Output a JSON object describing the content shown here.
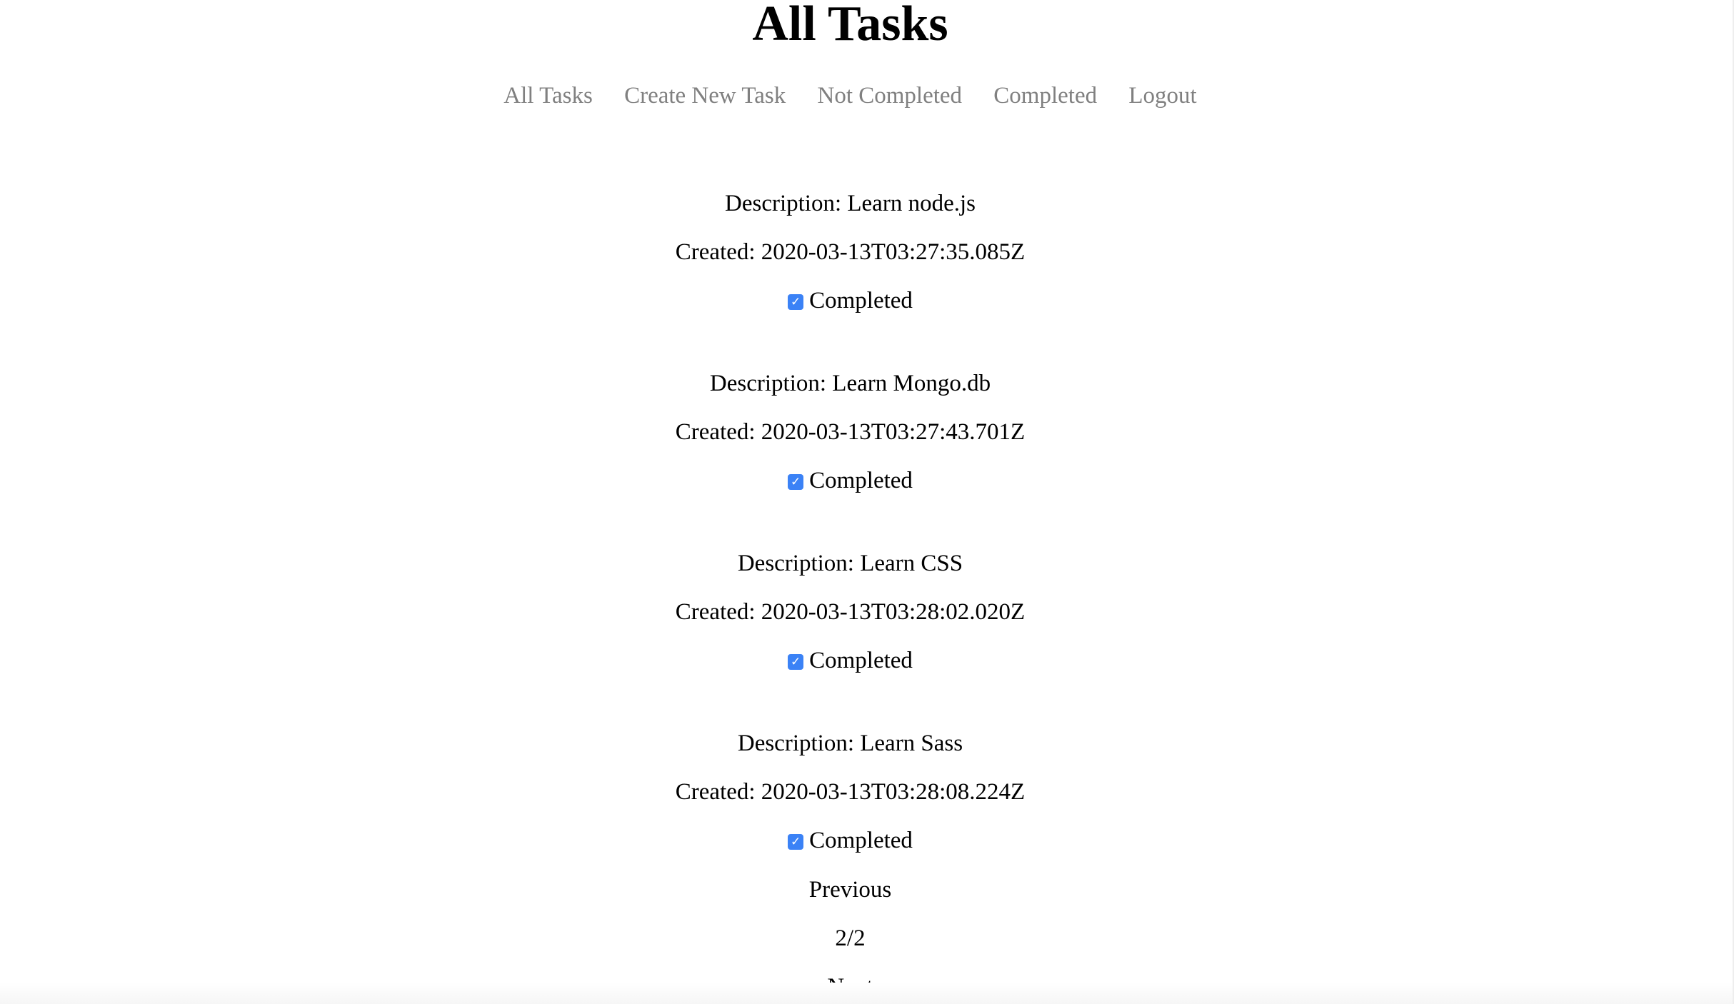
{
  "header": {
    "title": "All Tasks"
  },
  "nav": {
    "items": [
      {
        "label": "All Tasks"
      },
      {
        "label": "Create New Task"
      },
      {
        "label": "Not Completed"
      },
      {
        "label": "Completed"
      },
      {
        "label": "Logout"
      }
    ]
  },
  "tasks": [
    {
      "description": "Description: Learn node.js",
      "created": "Created: 2020-03-13T03:27:35.085Z",
      "completed_label": "Completed",
      "checked": true
    },
    {
      "description": "Description: Learn Mongo.db",
      "created": "Created: 2020-03-13T03:27:43.701Z",
      "completed_label": "Completed",
      "checked": true
    },
    {
      "description": "Description: Learn CSS",
      "created": "Created: 2020-03-13T03:28:02.020Z",
      "completed_label": "Completed",
      "checked": true
    },
    {
      "description": "Description: Learn Sass",
      "created": "Created: 2020-03-13T03:28:08.224Z",
      "completed_label": "Completed",
      "checked": true
    }
  ],
  "pagination": {
    "previous_label": "Previous",
    "page_indicator": "2/2",
    "next_label": "Next"
  },
  "colors": {
    "nav_link": "#808080",
    "checkbox": "#3b82f6"
  },
  "icons": {
    "checkbox": "checkmark-icon"
  }
}
